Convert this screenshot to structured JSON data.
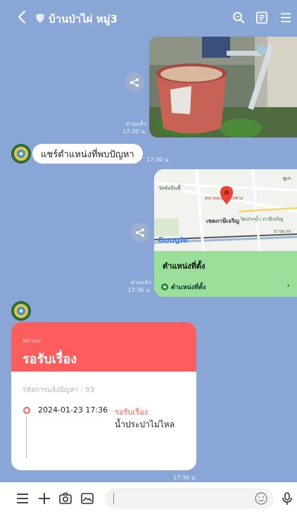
{
  "header": {
    "title": "บ้านป่าไผ่ หมู่3"
  },
  "messages": {
    "photo_read": "อ่านแล้ว",
    "photo_time": "17:30 น.",
    "share_text": "แชร์ตำแหน่งที่พบปัญหา",
    "share_time": "17:30 น.",
    "location": {
      "map_labels": [
        "วัดซ้อนี่นพื้",
        "ตลาดดอนบางพวง",
        "เขตภาษีเจริญ",
        "วัดปากน้ำ ภาษีเจริญ",
        "Google",
        "บางแวก",
        "ดูเก"
      ],
      "title": "ตำแหน่งที่ตั้ง",
      "link": "ตำแหน่งที่ตั้ง"
    },
    "location_read": "อ่านแล้ว",
    "location_time": "17:36 น.",
    "status_card": {
      "label": "สถานะ",
      "value": "รอรับเรื่อง",
      "ticket": "รหัสการแจ้งปัญหา : 93",
      "timeline_date": "2024-01-23 17:36",
      "timeline_status": "รอรับเรื่อง",
      "timeline_desc": "น้ำประปาไม่ไหล"
    },
    "status_time": "17:36 น."
  },
  "colors": {
    "background": "#8aa6d6",
    "status_red": "#fd5d5c",
    "location_green": "#9be09a"
  }
}
